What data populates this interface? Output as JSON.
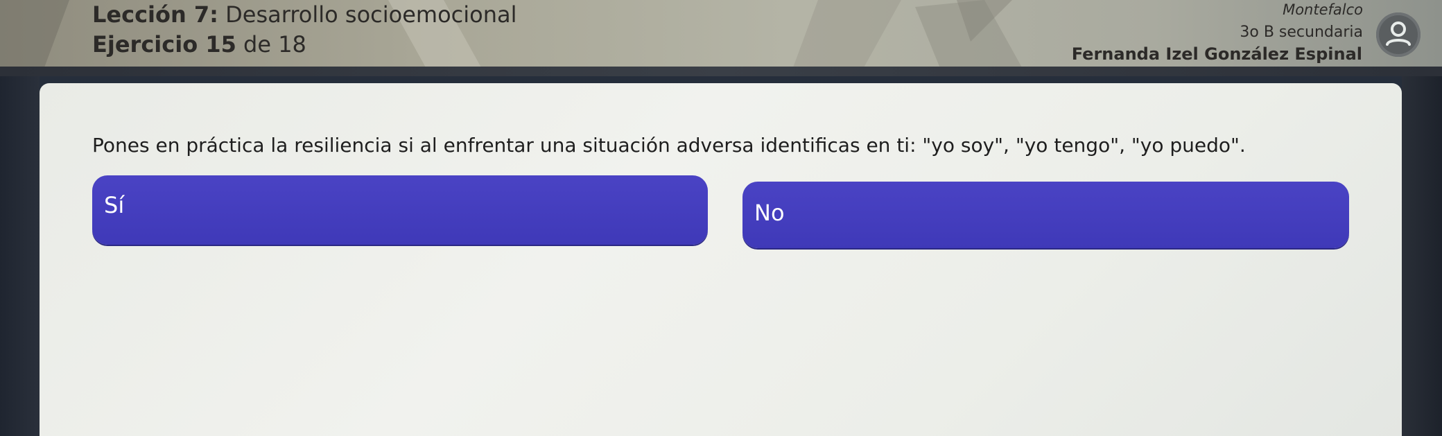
{
  "header": {
    "lesson_prefix": "Lección 7:",
    "lesson_name": "Desarrollo socioemocional",
    "exercise_prefix": "Ejercicio 15",
    "exercise_suffix": "de 18",
    "school": "Montefalco",
    "grade": "3o B secundaria",
    "student": "Fernanda Izel González Espinal",
    "avatar_icon": "user-avatar-icon"
  },
  "question": {
    "text": "Pones en práctica la resiliencia si al enfrentar una situación adversa identificas en ti: \"yo soy\", \"yo tengo\", \"yo puedo\"."
  },
  "options": [
    {
      "label": "Sí"
    },
    {
      "label": "No"
    }
  ],
  "colors": {
    "option_bg": "#4540be",
    "card_bg": "#eeefeb",
    "header_bg": "#a9a797"
  }
}
